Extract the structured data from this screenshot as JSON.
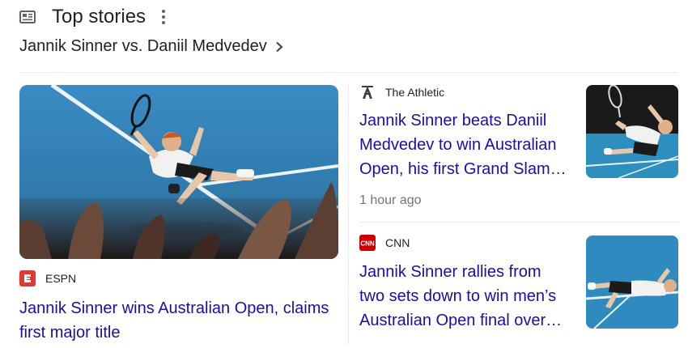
{
  "header": {
    "title": "Top stories",
    "icon": "news-icon",
    "more_icon": "more-vert-icon"
  },
  "topic": {
    "label": "Jannik Sinner vs. Daniil Medvedev",
    "icon": "chevron-right-icon"
  },
  "lead_story": {
    "source": "ESPN",
    "source_color": "#e23a33",
    "headline": "Jannik Sinner wins Australian Open, claims first major title",
    "image": "tennis player lying on court celebrating with crowd hands in foreground"
  },
  "side_stories": [
    {
      "source": "The Athletic",
      "headline": "Jannik Sinner beats Daniil Medvedev to win Australian Open, his first Grand Slam…",
      "time": "1 hour ago",
      "image": "tennis player falling on court celebrating"
    },
    {
      "source": "CNN",
      "source_color": "#cc0000",
      "headline": "Jannik Sinner rallies from two sets down to win men’s Australian Open final over…",
      "image": "tennis player lying on blue court"
    }
  ],
  "colors": {
    "link": "#1a0dab",
    "court": "#2f7fb6",
    "meta": "#70757a"
  }
}
